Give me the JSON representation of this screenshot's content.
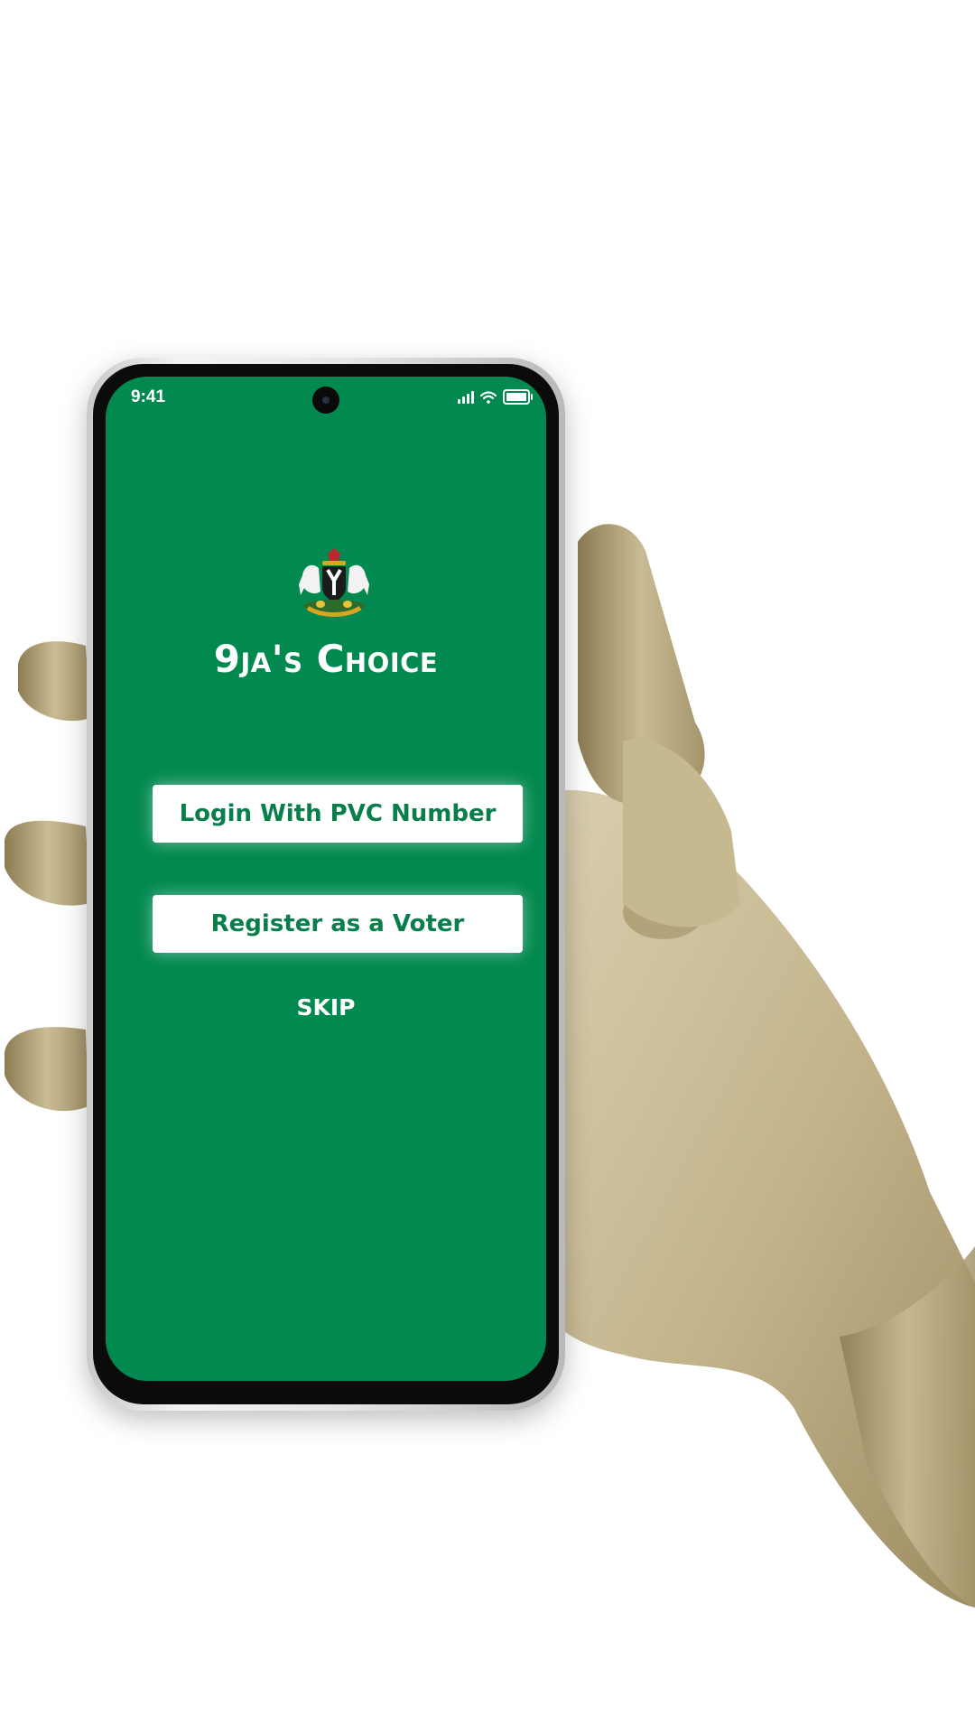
{
  "status_bar": {
    "time": "9:41"
  },
  "app": {
    "title": "9ja's Choice"
  },
  "actions": {
    "login_label": "Login With PVC Number",
    "register_label": "Register as a Voter",
    "skip_label": "SKIP"
  },
  "colors": {
    "screen_background": "#02894F",
    "button_text": "#087F4A",
    "button_background": "#FFFFFF"
  }
}
